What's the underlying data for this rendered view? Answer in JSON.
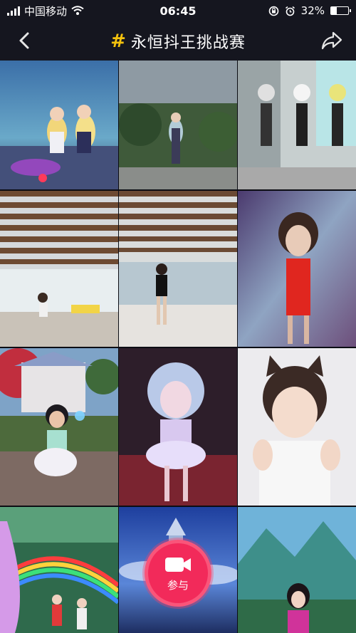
{
  "status_bar": {
    "carrier": "中国移动",
    "time": "06:45",
    "battery": "32%",
    "battery_level": 0.32
  },
  "header": {
    "hash_symbol": "#",
    "title": "永恒抖王挑战赛",
    "back_icon": "chevron-left-icon",
    "share_icon": "share-arrow-icon"
  },
  "videos": [
    {
      "scene": "game-dancers-neon"
    },
    {
      "scene": "game-girl-garden-glow"
    },
    {
      "scene": "game-trio-monochrome"
    },
    {
      "scene": "dance-studio-ceiling"
    },
    {
      "scene": "dancer-hall-black-outfit"
    },
    {
      "scene": "painted-girl-red-dress"
    },
    {
      "scene": "game-girl-garden-white-dress"
    },
    {
      "scene": "game-girl-blue-hair"
    },
    {
      "scene": "selfie-cat-ears"
    },
    {
      "scene": "fantasy-rainbow-butterfly"
    },
    {
      "scene": "fantasy-sky-castle"
    },
    {
      "scene": "fantasy-mountain-girl"
    }
  ],
  "join_button": {
    "label": "参与",
    "icon": "video-camera-icon"
  },
  "colors": {
    "accent": "#f22a5a",
    "hashtag": "#f4c20d",
    "bar": "#15161f"
  }
}
